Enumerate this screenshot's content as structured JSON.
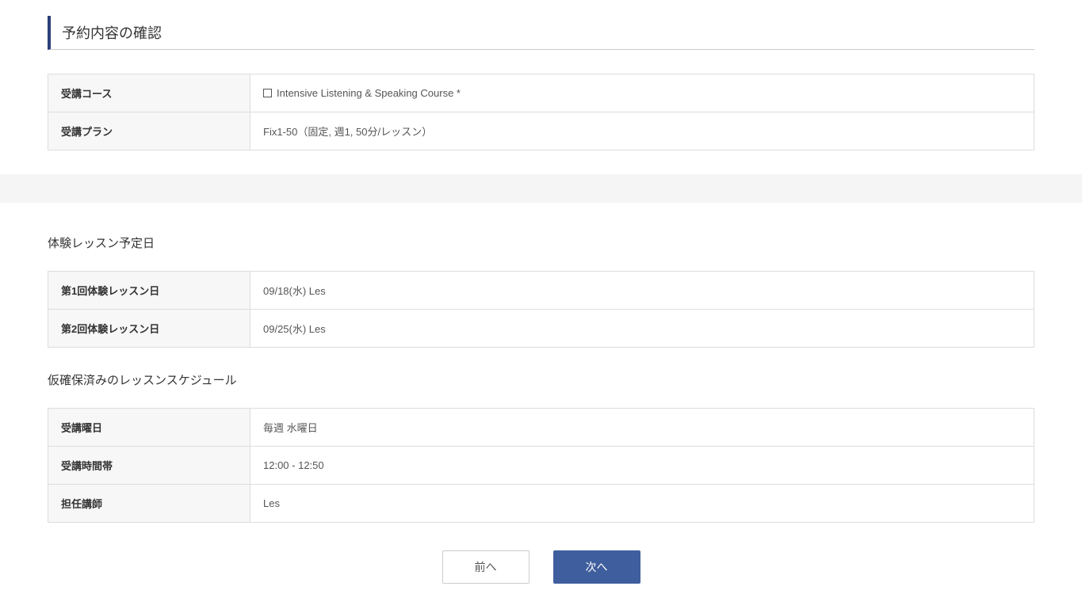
{
  "page_title": "予約内容の確認",
  "course_info": {
    "rows": [
      {
        "label": "受講コース",
        "value": "Intensive Listening & Speaking Course *",
        "has_icon": true
      },
      {
        "label": "受講プラン",
        "value": "Fix1-50（固定, 週1, 50分/レッスン）",
        "has_icon": false
      }
    ]
  },
  "trial_section": {
    "heading": "体験レッスン予定日",
    "rows": [
      {
        "label": "第1回体験レッスン日",
        "value": "09/18(水) Les"
      },
      {
        "label": "第2回体験レッスン日",
        "value": "09/25(水) Les"
      }
    ]
  },
  "schedule_section": {
    "heading": "仮確保済みのレッスンスケジュール",
    "rows": [
      {
        "label": "受講曜日",
        "value": "毎週 水曜日"
      },
      {
        "label": "受講時間帯",
        "value": "12:00 - 12:50"
      },
      {
        "label": "担任講師",
        "value": "Les"
      }
    ]
  },
  "buttons": {
    "prev": "前へ",
    "next": "次へ"
  }
}
